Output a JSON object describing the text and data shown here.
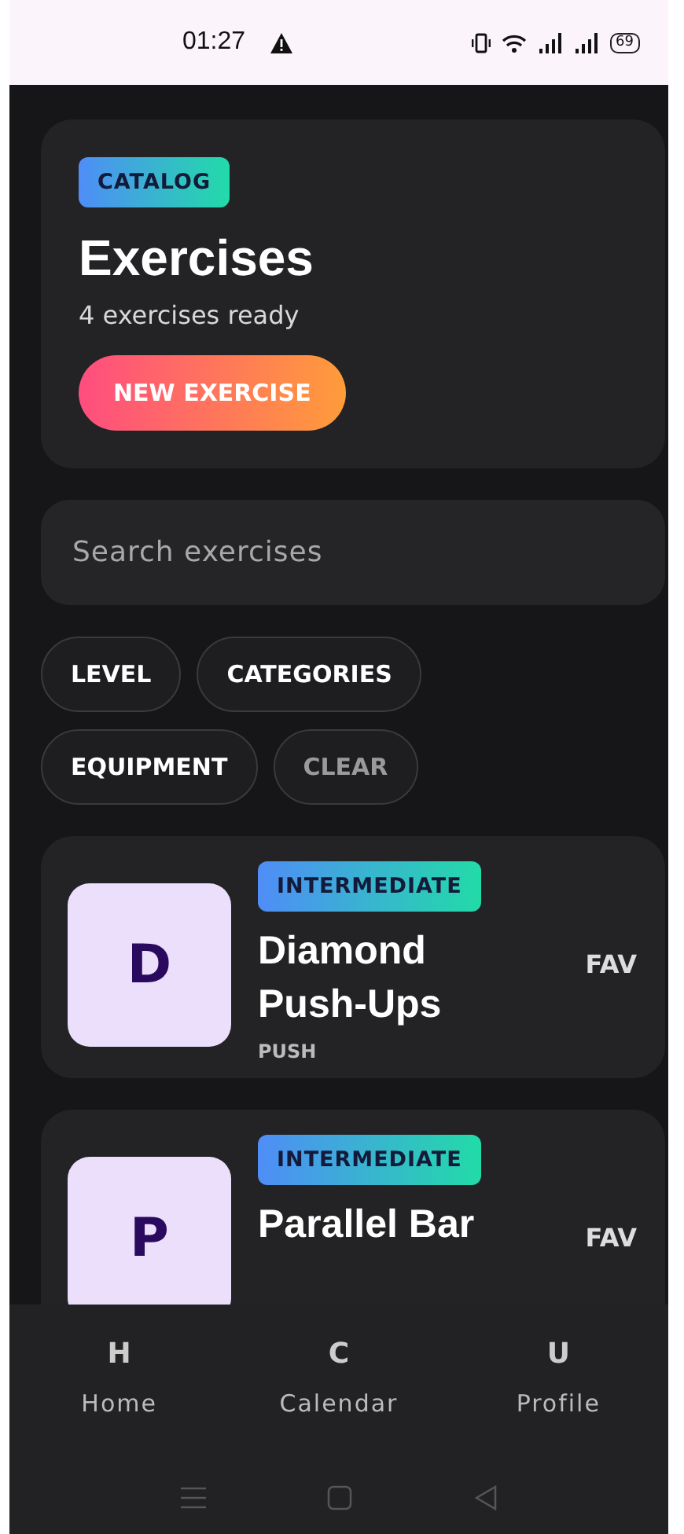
{
  "status_bar": {
    "time": "01:27",
    "battery": "69"
  },
  "header": {
    "badge": "CATALOG",
    "title": "Exercises",
    "subtitle": "4 exercises ready",
    "button": "NEW EXERCISE"
  },
  "search": {
    "placeholder": "Search exercises"
  },
  "filters": [
    {
      "label": "LEVEL",
      "disabled": false
    },
    {
      "label": "CATEGORIES",
      "disabled": false
    },
    {
      "label": "EQUIPMENT",
      "disabled": false
    },
    {
      "label": "CLEAR",
      "disabled": true
    }
  ],
  "exercises": [
    {
      "initial": "D",
      "level": "INTERMEDIATE",
      "name": "Diamond Push-Ups",
      "category": "PUSH",
      "fav": "FAV"
    },
    {
      "initial": "P",
      "level": "INTERMEDIATE",
      "name": "Parallel Bar",
      "fav": "FAV"
    }
  ],
  "nav": [
    {
      "icon": "H",
      "label": "Home"
    },
    {
      "icon": "C",
      "label": "Calendar"
    },
    {
      "icon": "U",
      "label": "Profile"
    }
  ]
}
